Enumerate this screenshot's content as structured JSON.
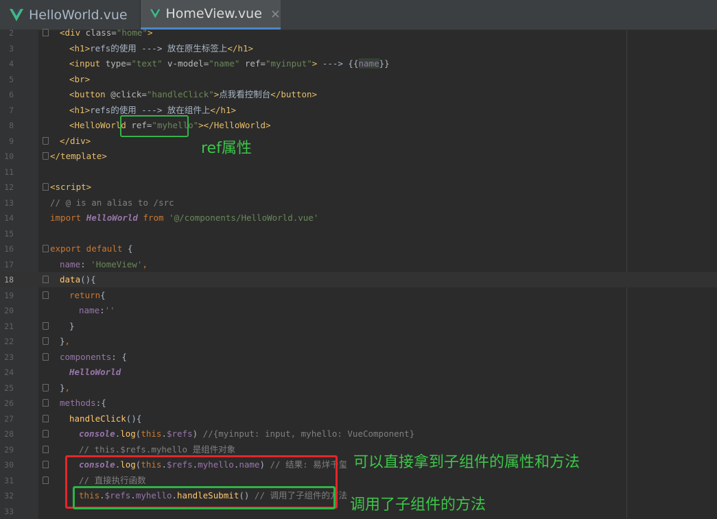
{
  "tabs": [
    {
      "label": "HelloWorld.vue",
      "active": false
    },
    {
      "label": "HomeView.vue",
      "active": true,
      "close": "×"
    }
  ],
  "editor": {
    "current_line": 18,
    "lines": [
      {
        "n": "2",
        "segs": [
          [
            "tag",
            "<div "
          ],
          [
            "attr",
            "class="
          ],
          [
            "str",
            "\"home\""
          ],
          [
            "tag",
            ">"
          ]
        ]
      },
      {
        "n": "3",
        "segs": [
          [
            "tag",
            "<h1>"
          ],
          [
            "plain",
            "refs的使用 ---> 放在原生标签上"
          ],
          [
            "tag",
            "</h1>"
          ]
        ]
      },
      {
        "n": "4",
        "segs": [
          [
            "tag",
            "<input "
          ],
          [
            "attr",
            "type="
          ],
          [
            "str",
            "\"text\""
          ],
          [
            "attr",
            " v-model="
          ],
          [
            "str",
            "\"name\""
          ],
          [
            "attr",
            " ref="
          ],
          [
            "str",
            "\"myinput\""
          ],
          [
            "tag",
            ">"
          ],
          [
            "plain",
            " ---> {{"
          ],
          [
            "tv",
            "name"
          ],
          [
            "plain",
            "}}"
          ]
        ]
      },
      {
        "n": "5",
        "segs": [
          [
            "tag",
            "<br>"
          ]
        ]
      },
      {
        "n": "6",
        "segs": [
          [
            "tag",
            "<button "
          ],
          [
            "attr",
            "@click="
          ],
          [
            "str",
            "\"handleClick\""
          ],
          [
            "tag",
            ">"
          ],
          [
            "plain",
            "点我看控制台"
          ],
          [
            "tag",
            "</button>"
          ]
        ]
      },
      {
        "n": "7",
        "segs": [
          [
            "tag",
            "<h1>"
          ],
          [
            "plain",
            "refs的使用 ---> 放在组件上"
          ],
          [
            "tag",
            "</h1>"
          ]
        ]
      },
      {
        "n": "8",
        "segs": [
          [
            "tag",
            "<HelloWorld "
          ],
          [
            "attr",
            "ref="
          ],
          [
            "str",
            "\"myhello\""
          ],
          [
            "tag",
            "></HelloWorld>"
          ]
        ]
      },
      {
        "n": "9",
        "segs": [
          [
            "tag",
            "</div>"
          ]
        ]
      },
      {
        "n": "10",
        "segs": [
          [
            "tag",
            "</template>"
          ]
        ]
      },
      {
        "n": "11",
        "segs": []
      },
      {
        "n": "12",
        "segs": [
          [
            "tag",
            "<script>"
          ]
        ]
      },
      {
        "n": "13",
        "segs": [
          [
            "cmt",
            "// @ is an alias to /src"
          ]
        ]
      },
      {
        "n": "14",
        "segs": [
          [
            "kw",
            "import "
          ],
          [
            "cls",
            "HelloWorld"
          ],
          [
            "kw",
            " from "
          ],
          [
            "str",
            "'@/components/HelloWorld.vue'"
          ]
        ]
      },
      {
        "n": "15",
        "segs": []
      },
      {
        "n": "16",
        "segs": [
          [
            "kw",
            "export default "
          ],
          [
            "plain",
            "{"
          ]
        ]
      },
      {
        "n": "17",
        "segs": [
          [
            "prop",
            "name"
          ],
          [
            "plain",
            ": "
          ],
          [
            "str",
            "'HomeView'"
          ],
          [
            "kw",
            ","
          ]
        ]
      },
      {
        "n": "18",
        "segs": [
          [
            "fn",
            "data"
          ],
          [
            "plain",
            "(){"
          ]
        ]
      },
      {
        "n": "19",
        "segs": [
          [
            "kw",
            "return"
          ],
          [
            "plain",
            "{"
          ]
        ]
      },
      {
        "n": "20",
        "segs": [
          [
            "prop",
            "name"
          ],
          [
            "plain",
            ":"
          ],
          [
            "str",
            "''"
          ]
        ]
      },
      {
        "n": "21",
        "segs": [
          [
            "plain",
            "}"
          ]
        ]
      },
      {
        "n": "22",
        "segs": [
          [
            "plain",
            "}"
          ],
          [
            "kw",
            ","
          ]
        ]
      },
      {
        "n": "23",
        "segs": [
          [
            "prop",
            "components"
          ],
          [
            "plain",
            ": {"
          ]
        ]
      },
      {
        "n": "24",
        "segs": [
          [
            "cls",
            "HelloWorld"
          ]
        ]
      },
      {
        "n": "25",
        "segs": [
          [
            "plain",
            "}"
          ],
          [
            "kw",
            ","
          ]
        ]
      },
      {
        "n": "26",
        "segs": [
          [
            "prop",
            "methods"
          ],
          [
            "plain",
            ":{"
          ]
        ]
      },
      {
        "n": "27",
        "segs": [
          [
            "fn",
            "handleClick"
          ],
          [
            "plain",
            "(){"
          ]
        ]
      },
      {
        "n": "28",
        "segs": [
          [
            "cls",
            "console"
          ],
          [
            "plain",
            "."
          ],
          [
            "fn",
            "log"
          ],
          [
            "plain",
            "("
          ],
          [
            "kw",
            "this"
          ],
          [
            "plain",
            "."
          ],
          [
            "prop",
            "$refs"
          ],
          [
            "plain",
            ") "
          ],
          [
            "cmt",
            "//{myinput: input, myhello: VueComponent}"
          ]
        ]
      },
      {
        "n": "29",
        "segs": [
          [
            "cmt",
            "// this.$refs.myhello 是组件对象"
          ]
        ]
      },
      {
        "n": "30",
        "segs": [
          [
            "cls",
            "console"
          ],
          [
            "plain",
            "."
          ],
          [
            "fn",
            "log"
          ],
          [
            "plain",
            "("
          ],
          [
            "kw",
            "this"
          ],
          [
            "plain",
            "."
          ],
          [
            "prop",
            "$refs"
          ],
          [
            "plain",
            "."
          ],
          [
            "prop",
            "myhello"
          ],
          [
            "plain",
            "."
          ],
          [
            "prop",
            "name"
          ],
          [
            "plain",
            ") "
          ],
          [
            "cmt",
            "// 结果: 易烊千玺"
          ]
        ]
      },
      {
        "n": "31",
        "segs": [
          [
            "cmt",
            "// 直接执行函数"
          ]
        ]
      },
      {
        "n": "32",
        "segs": [
          [
            "kw",
            "this"
          ],
          [
            "plain",
            "."
          ],
          [
            "prop",
            "$refs"
          ],
          [
            "plain",
            "."
          ],
          [
            "prop",
            "myhello"
          ],
          [
            "plain",
            "."
          ],
          [
            "fn",
            "handleSubmit"
          ],
          [
            "plain",
            "() "
          ],
          [
            "cmt",
            "// 调用了子组件的方法"
          ]
        ]
      },
      {
        "n": "33",
        "segs": []
      }
    ]
  },
  "annotations": {
    "ref_attr": "ref属性",
    "access_props": "可以直接拿到子组件的属性和方法",
    "call_method": "调用了子组件的方法"
  },
  "colors": {
    "annotation_green": "#3dc64a",
    "annotation_red": "#e5262a",
    "tab_underline": "#4a88c7"
  }
}
